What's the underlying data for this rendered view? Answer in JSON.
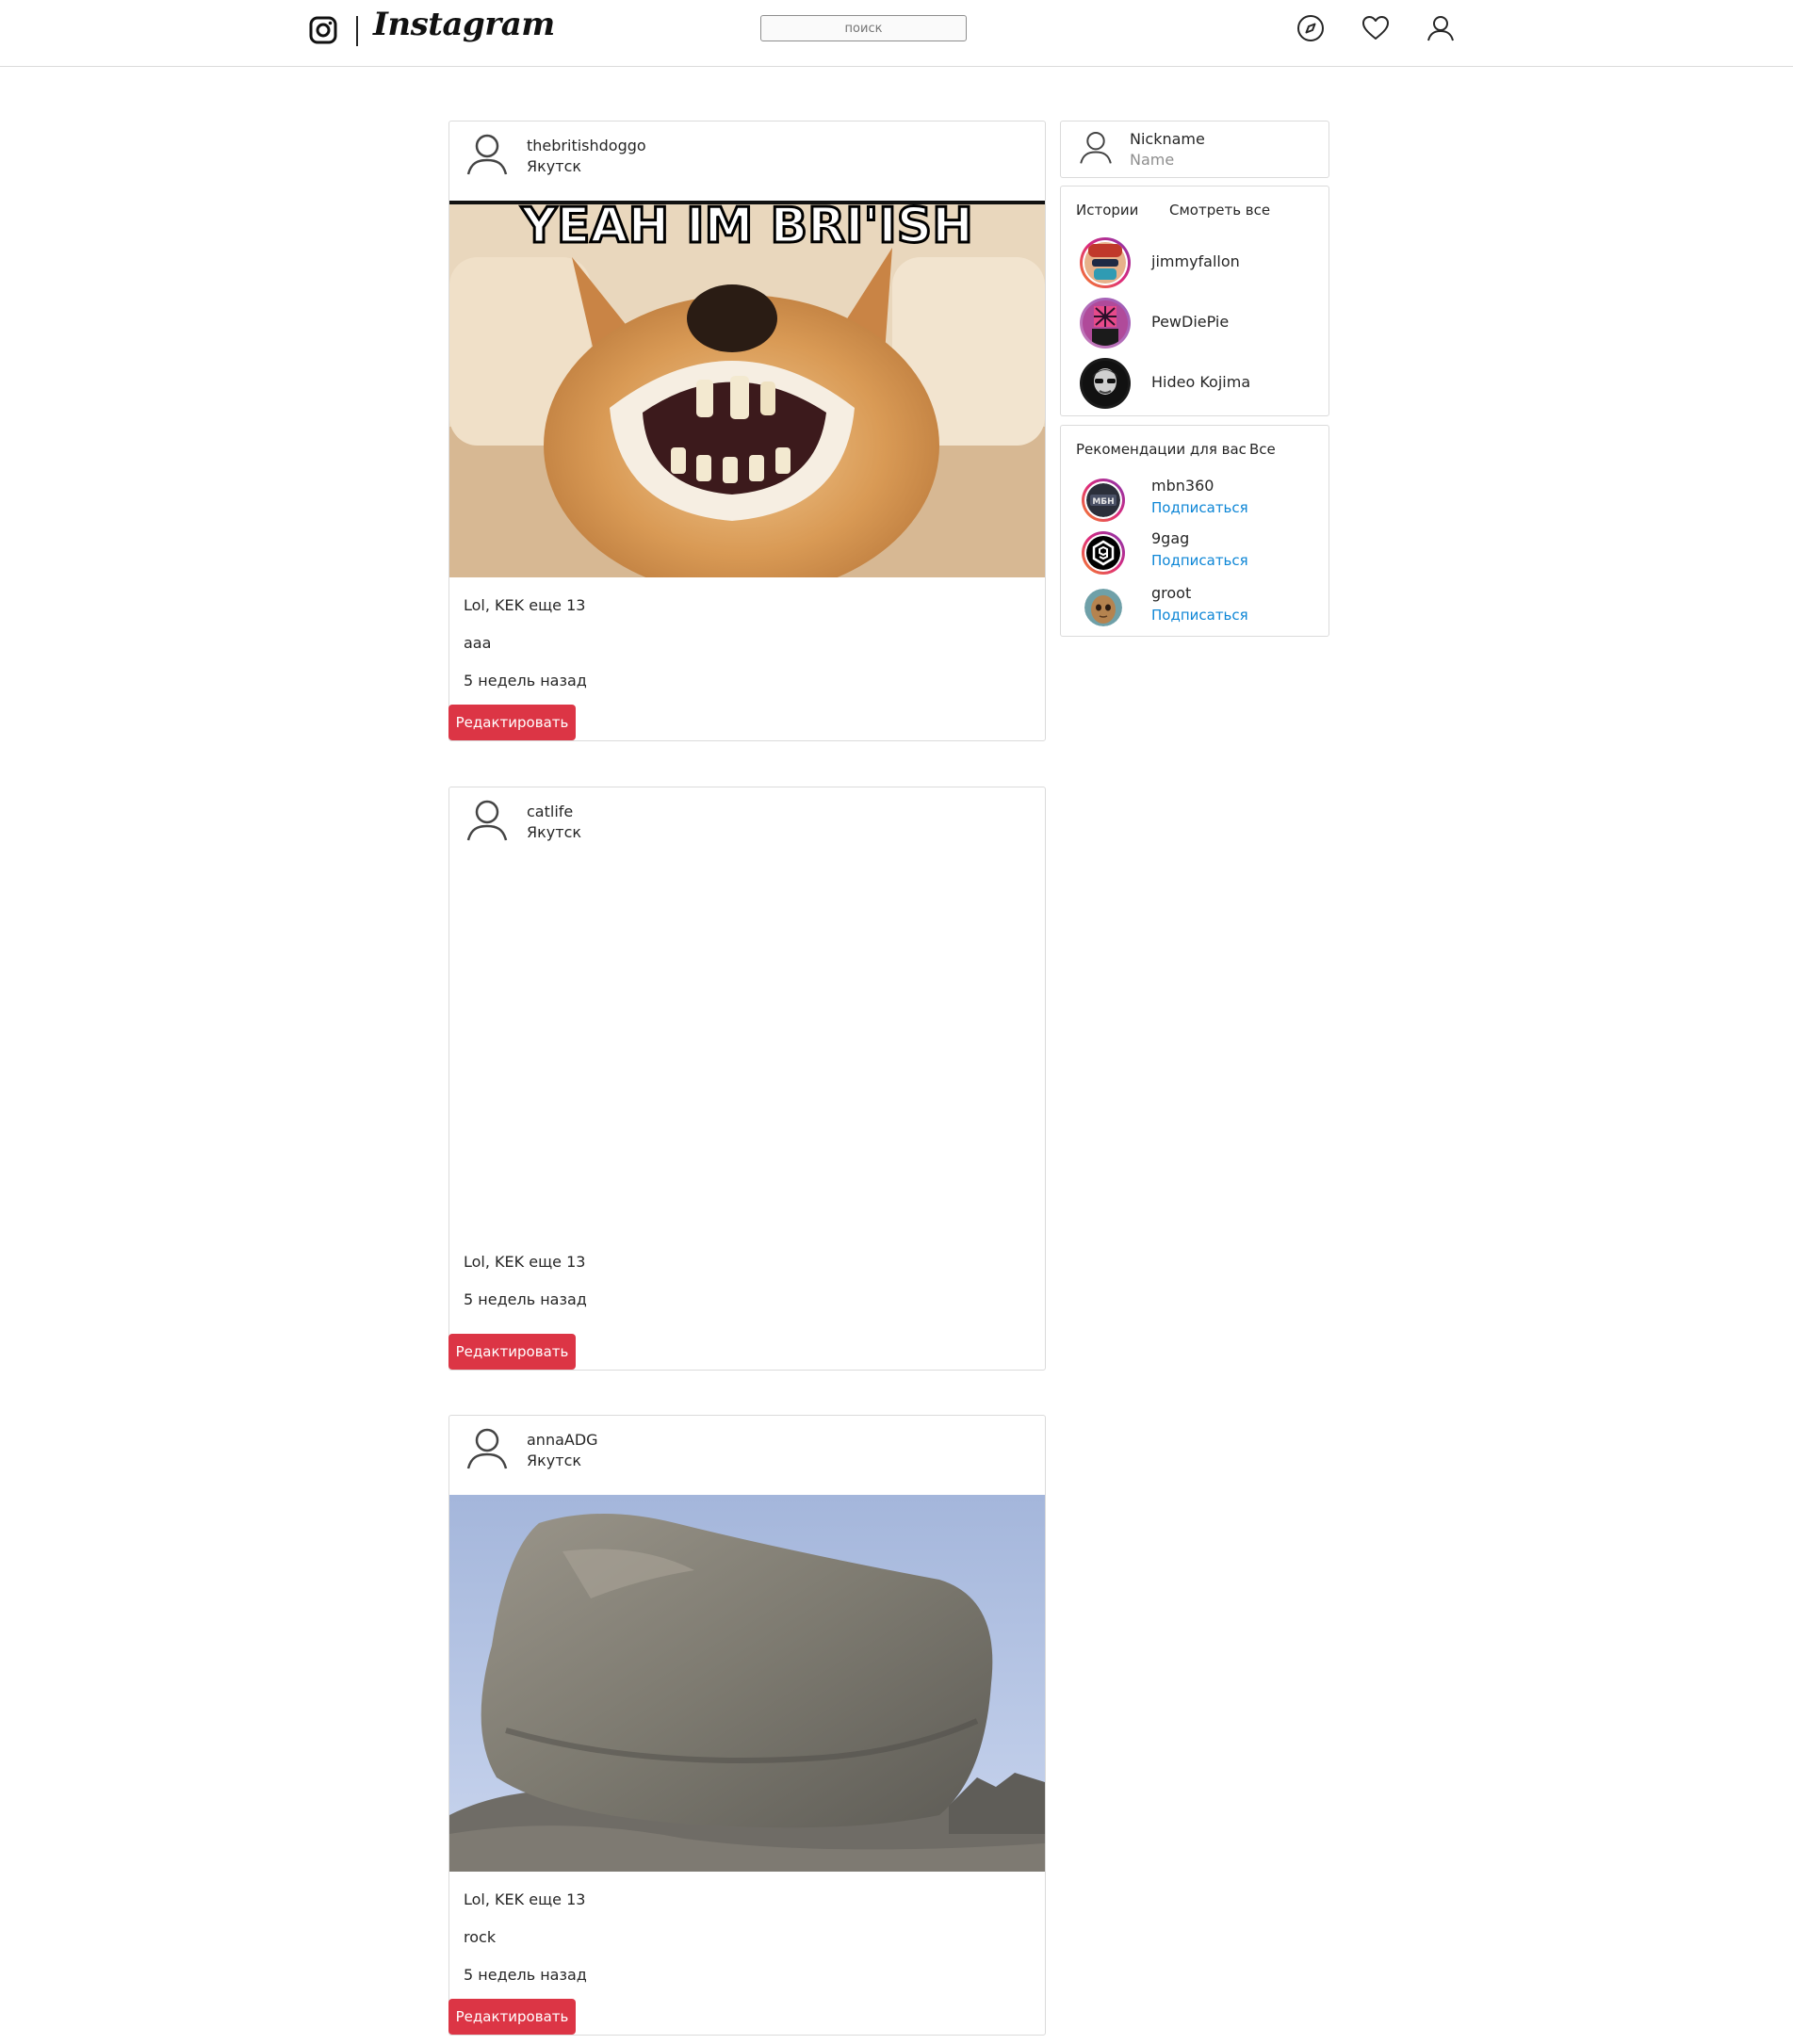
{
  "header": {
    "logo_text": "Instagram",
    "search_placeholder": "поиск",
    "icons": [
      "instagram-glyph-icon",
      "compass-icon",
      "heart-icon",
      "user-icon"
    ]
  },
  "posts": [
    {
      "username": "thebritishdoggo",
      "location": "Якутск",
      "media_caption": "YEAH IM BRI'ISH",
      "likes_text": "Lol, KEK еще 13",
      "caption": "aaa",
      "time": "5 недель назад",
      "edit_label": "Редактировать"
    },
    {
      "username": "catlife",
      "location": "Якутск",
      "likes_text": "Lol, KEK еще 13",
      "time": "5 недель назад",
      "edit_label": "Редактировать"
    },
    {
      "username": "annaADG",
      "location": "Якутск",
      "likes_text": "Lol, KEK еще 13",
      "caption": "rock",
      "time": "5 недель назад",
      "edit_label": "Редактировать"
    }
  ],
  "sidebar": {
    "profile": {
      "nickname": "Nickname",
      "name": "Name"
    },
    "stories": {
      "title": "Истории",
      "see_all": "Смотреть все",
      "items": [
        {
          "name": "jimmyfallon"
        },
        {
          "name": "PewDiePie"
        },
        {
          "name": "Hideo Kojima"
        }
      ]
    },
    "recommendations": {
      "title": "Рекомендации для вас",
      "all": "Все",
      "follow_label": "Подписаться",
      "items": [
        {
          "name": "mbn360",
          "badge": "МБН"
        },
        {
          "name": "9gag"
        },
        {
          "name": "groot"
        }
      ]
    }
  },
  "colors": {
    "accent_button": "#dc3545",
    "link_blue": "#0d86d6",
    "border": "#dbdbdb",
    "story_ring": "#e1306c"
  }
}
